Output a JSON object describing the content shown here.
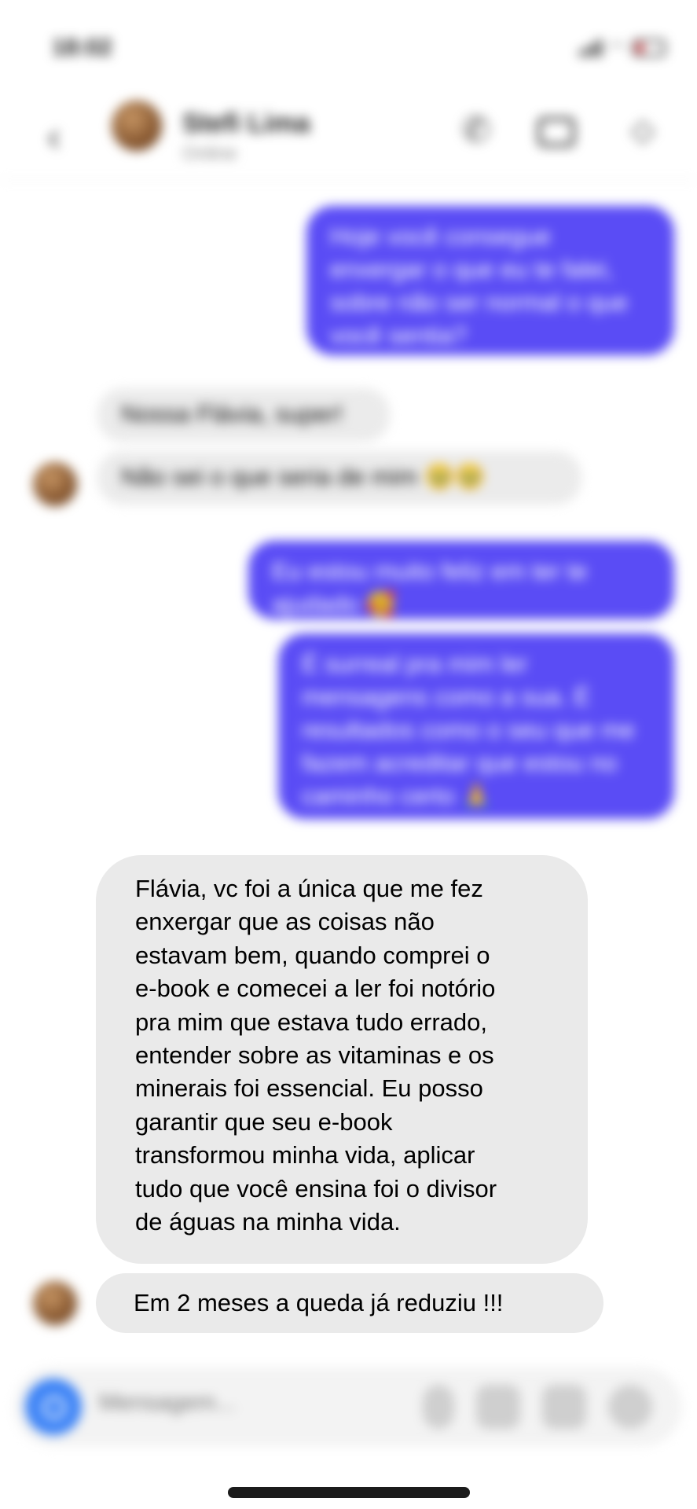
{
  "status_bar": {
    "time": "18:02"
  },
  "header": {
    "back_icon": "chevron-left-icon",
    "contact_name": "Stefi Lima",
    "contact_status": "Online",
    "icons": [
      "phone-icon",
      "video-camera-icon",
      "tag-icon"
    ]
  },
  "messages": {
    "out_1": "Hoje você consegue enxergar o que eu te falei, sobre não ser normal o que você sentia?",
    "in_1": "Nossa Flávia, super!",
    "in_2": "Não sei o que seria de mim 🥹🥹",
    "out_2": "Eu estou muito feliz em ter te ajudado 🥰",
    "out_3": "É surreal pra mim ler mensagens como a sua. É resultados como o seu que me fazem acreditar que estou no caminho certo 🙏",
    "in_3_lines": [
      "Flávia, vc foi a única que me fez",
      "enxergar que as coisas não",
      "estavam bem, quando comprei o",
      "e-book e comecei a ler foi notório",
      "pra mim que estava tudo errado,",
      "entender sobre as vitaminas e os",
      "minerais foi essencial. Eu posso",
      "garantir que seu e-book",
      "transformou minha vida, aplicar",
      "tudo que você ensina foi o divisor",
      "de águas na minha vida."
    ],
    "in_4": "Em 2 meses a queda já reduziu !!!"
  },
  "composer": {
    "placeholder": "Mensagem...",
    "icons": [
      "camera-icon",
      "microphone-icon",
      "image-icon",
      "sticker-icon",
      "add-icon"
    ]
  },
  "colors": {
    "outgoing_bubble": "#5a4cf5",
    "incoming_bubble": "#ebebeb",
    "camera_button": "#3b82f6"
  }
}
